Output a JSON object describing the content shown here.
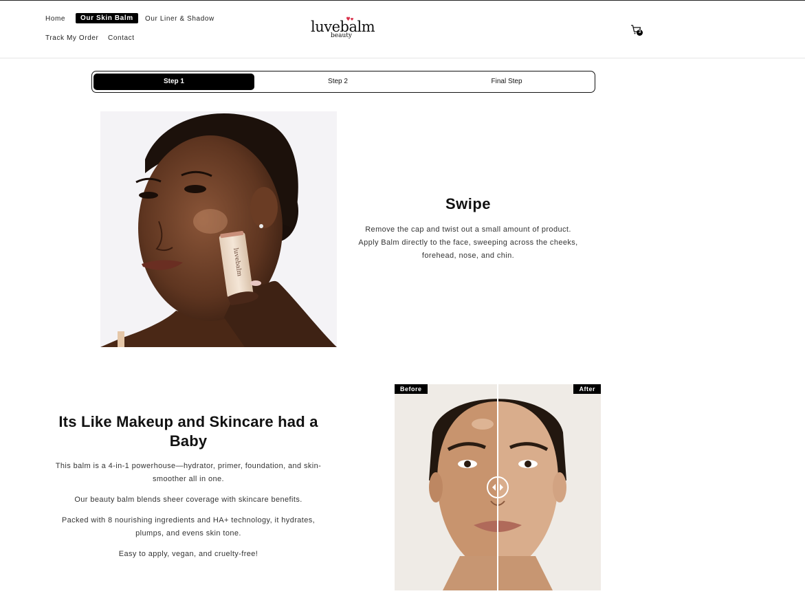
{
  "header": {
    "nav": [
      {
        "label": "Home"
      },
      {
        "label": "Our Skin Balm",
        "active": true
      },
      {
        "label": "Our Liner & Shadow"
      },
      {
        "label": "Track My Order"
      },
      {
        "label": "Contact"
      }
    ],
    "logo": {
      "main": "luvebalm",
      "sub": "beauty"
    },
    "cart": {
      "icon": "cart-icon",
      "count": "3"
    }
  },
  "steps": [
    {
      "label": "Step 1",
      "active": true
    },
    {
      "label": "Step 2"
    },
    {
      "label": "Final Step"
    }
  ],
  "step_content": {
    "image": "woman-applying-balm-stick",
    "product_label": "luvebalm",
    "title": "Swipe",
    "lines": [
      "Remove the cap and twist out a small amount of product.",
      "Apply Balm directly to the face, sweeping across the cheeks,",
      "forehead, nose, and chin."
    ]
  },
  "feature": {
    "title_line1": "Its Like Makeup and Skincare had a",
    "title_line2": "Baby",
    "paragraphs": [
      "This balm is a 4-in-1 powerhouse—hydrator, primer, foundation, and skin-",
      "smoother all in one.",
      "Our beauty balm blends sheer coverage with skincare benefits.",
      "Packed with 8 nourishing ingredients and HA+ technology, it hydrates,",
      "plumps, and evens skin tone.",
      "Easy to apply, vegan, and cruelty-free!"
    ]
  },
  "comparison": {
    "before_label": "Before",
    "after_label": "After",
    "handle_icon": "left-right-arrows-icon"
  },
  "colors": {
    "accent": "#000000",
    "heart": "#d9304a",
    "background": "#ffffff"
  }
}
